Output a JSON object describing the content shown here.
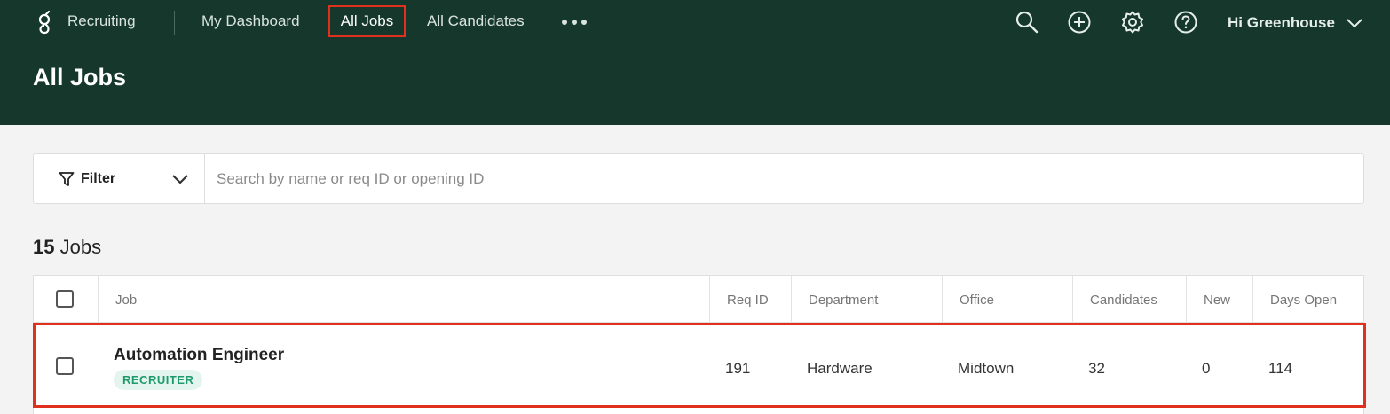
{
  "nav": {
    "product": "Recruiting",
    "links": {
      "dashboard": "My Dashboard",
      "all_jobs": "All Jobs",
      "all_candidates": "All Candidates"
    },
    "user": "Hi Greenhouse",
    "icons": [
      "greenhouse-logo-icon",
      "more-icon",
      "search-icon",
      "add-icon",
      "gear-icon",
      "help-icon",
      "chevron-down-icon"
    ]
  },
  "page": {
    "title": "All Jobs"
  },
  "filter": {
    "label": "Filter",
    "search_placeholder": "Search by name or req ID or opening ID"
  },
  "count": {
    "number": "15",
    "label": "Jobs"
  },
  "table": {
    "headers": {
      "job": "Job",
      "req_id": "Req ID",
      "department": "Department",
      "office": "Office",
      "candidates": "Candidates",
      "new": "New",
      "days_open": "Days Open"
    },
    "rows": [
      {
        "job": "Automation Engineer",
        "badge": "RECRUITER",
        "req_id": "191",
        "department": "Hardware",
        "office": "Midtown",
        "candidates": "32",
        "new": "0",
        "days_open": "114"
      }
    ]
  },
  "colors": {
    "header_bg": "#15372c",
    "highlight": "#e0301e",
    "badge_text": "#1f9a6b",
    "badge_bg": "#e3f5ee"
  }
}
